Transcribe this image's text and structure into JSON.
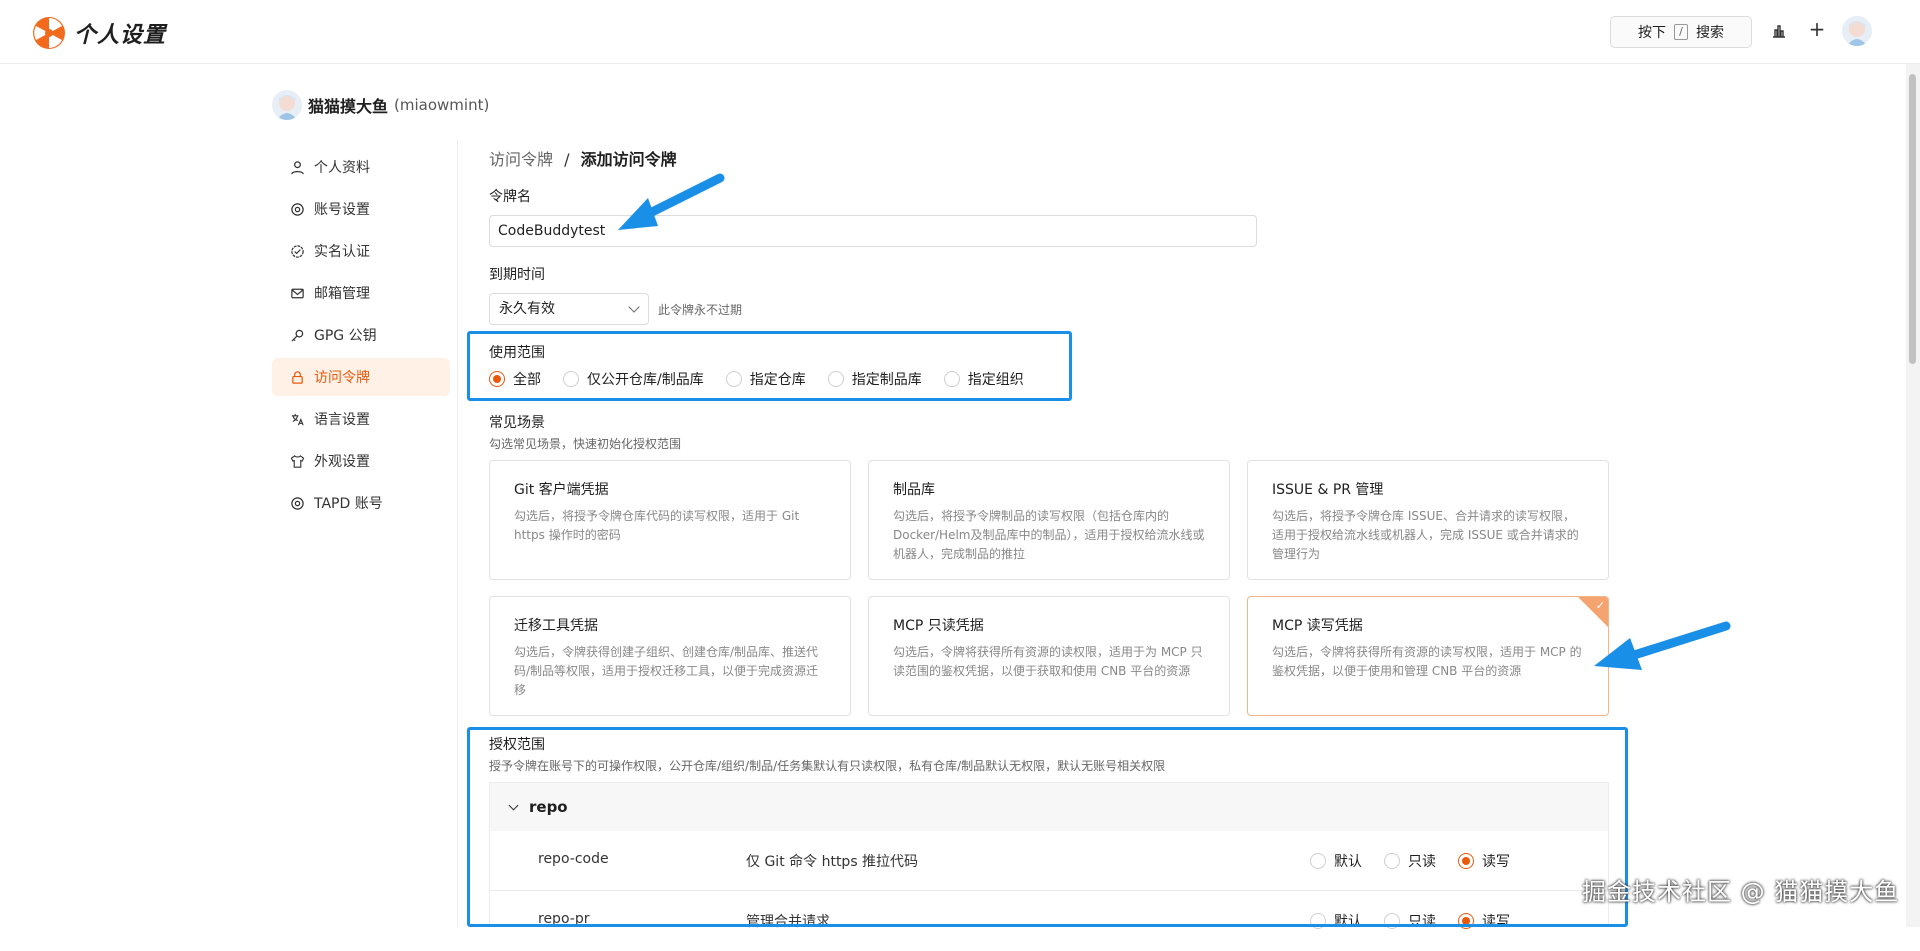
{
  "header": {
    "title": "个人设置",
    "search_prefix": "按下",
    "search_key": "/",
    "search_label": "搜索",
    "plus": "+"
  },
  "user": {
    "name": "猫猫摸大鱼",
    "handle": "(miaowmint)"
  },
  "sidebar": {
    "items": [
      {
        "label": "个人资料",
        "icon": "user-icon"
      },
      {
        "label": "账号设置",
        "icon": "gear-icon"
      },
      {
        "label": "实名认证",
        "icon": "verified-icon"
      },
      {
        "label": "邮箱管理",
        "icon": "mail-icon"
      },
      {
        "label": "GPG 公钥",
        "icon": "key-icon"
      },
      {
        "label": "访问令牌",
        "icon": "lock-icon",
        "active": true
      },
      {
        "label": "语言设置",
        "icon": "language-icon"
      },
      {
        "label": "外观设置",
        "icon": "shirt-icon"
      },
      {
        "label": "TAPD 账号",
        "icon": "gear-icon"
      }
    ]
  },
  "breadcrumb": {
    "parent": "访问令牌",
    "sep": "/",
    "current": "添加访问令牌"
  },
  "form": {
    "token_name_label": "令牌名",
    "token_name_value": "CodeBuddytest",
    "expiry_label": "到期时间",
    "expiry_value": "永久有效",
    "expiry_hint": "此令牌永不过期",
    "scope_label": "使用范围",
    "scope_options": [
      "全部",
      "仅公开仓库/制品库",
      "指定仓库",
      "指定制品库",
      "指定组织"
    ],
    "scope_selected": "全部",
    "scenario_label": "常见场景",
    "scenario_hint": "勾选常见场景，快速初始化授权范围"
  },
  "scenarios": [
    {
      "title": "Git 客户端凭据",
      "desc": "勾选后，将授予令牌仓库代码的读写权限，适用于 Git https 操作时的密码"
    },
    {
      "title": "制品库",
      "desc": "勾选后，将授予令牌制品的读写权限（包括仓库内的 Docker/Helm及制品库中的制品），适用于授权给流水线或机器人，完成制品的推拉"
    },
    {
      "title": "ISSUE & PR 管理",
      "desc": "勾选后，将授予令牌仓库 ISSUE、合并请求的读写权限，适用于授权给流水线或机器人，完成 ISSUE 或合并请求的管理行为"
    },
    {
      "title": "迁移工具凭据",
      "desc": "勾选后，令牌获得创建子组织、创建仓库/制品库、推送代码/制品等权限，适用于授权迁移工具，以便于完成资源迁移"
    },
    {
      "title": "MCP 只读凭据",
      "desc": "勾选后，令牌将获得所有资源的读权限，适用于为 MCP 只读范围的鉴权凭据，以便于获取和使用 CNB 平台的资源"
    },
    {
      "title": "MCP 读写凭据",
      "desc": "勾选后，令牌将获得所有资源的读写权限，适用于 MCP 的鉴权凭据，以便于使用和管理 CNB 平台的资源",
      "selected": true,
      "check": "✓"
    }
  ],
  "permissions": {
    "label": "授权范围",
    "hint": "授予令牌在账号下的可操作权限，公开仓库/组织/制品/任务集默认有只读权限，私有仓库/制品默认无权限，默认无账号相关权限",
    "group": "repo",
    "options": [
      "默认",
      "只读",
      "读写"
    ],
    "rows": [
      {
        "name": "repo-code",
        "desc": "仅 Git 命令 https 推拉代码",
        "selected": "读写"
      },
      {
        "name": "repo-pr",
        "desc": "管理合并请求",
        "selected": "读写"
      }
    ]
  },
  "watermark": "掘金技术社区 @ 猫猫摸大鱼",
  "colors": {
    "accent": "#e8590c",
    "annotation": "#1a8fe8"
  }
}
